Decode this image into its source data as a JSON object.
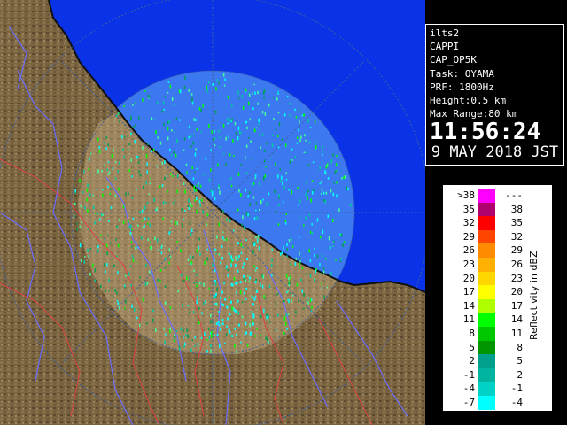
{
  "info": {
    "lines": [
      "ilts2",
      "CAPPI",
      "CAP_OP5K",
      "Task: OYAMA",
      "PRF: 1800Hz",
      "Height:0.5 km",
      "Max Range:80 km"
    ],
    "time": "11:56:24",
    "date": "9 MAY 2018 JST"
  },
  "legend": {
    "unit_label": "Reflectivity in dBZ",
    "rows": [
      {
        "low": ">38",
        "high": "---",
        "color": "#ff00ff"
      },
      {
        "low": "35",
        "high": "38",
        "color": "#b0006e"
      },
      {
        "low": "32",
        "high": "35",
        "color": "#ff0000"
      },
      {
        "low": "29",
        "high": "32",
        "color": "#ff4500"
      },
      {
        "low": "26",
        "high": "29",
        "color": "#ff8c00"
      },
      {
        "low": "23",
        "high": "26",
        "color": "#ffb000"
      },
      {
        "low": "20",
        "high": "23",
        "color": "#ffd700"
      },
      {
        "low": "17",
        "high": "20",
        "color": "#ffff00"
      },
      {
        "low": "14",
        "high": "17",
        "color": "#b0ff00"
      },
      {
        "low": "11",
        "high": "14",
        "color": "#00ff00"
      },
      {
        "low": "8",
        "high": "11",
        "color": "#00c800"
      },
      {
        "low": "5",
        "high": "8",
        "color": "#009600"
      },
      {
        "low": "2",
        "high": "5",
        "color": "#00a08c"
      },
      {
        "low": "-1",
        "high": "2",
        "color": "#00b4a0"
      },
      {
        "low": "-4",
        "high": "-1",
        "color": "#00d2c8"
      },
      {
        "low": "-7",
        "high": "-4",
        "color": "#00ffff"
      }
    ]
  },
  "map": {
    "sea_color": "#0a32e6",
    "land_color": "#7a6440",
    "coverage_color": "#3c78f0",
    "river_color": "#6a6cff",
    "boundary_color": "#e04040",
    "coast_color": "#101010",
    "echo_colors": [
      "#00c8a0",
      "#00ff00",
      "#00a050",
      "#40ffa0",
      "#00ffff"
    ]
  }
}
